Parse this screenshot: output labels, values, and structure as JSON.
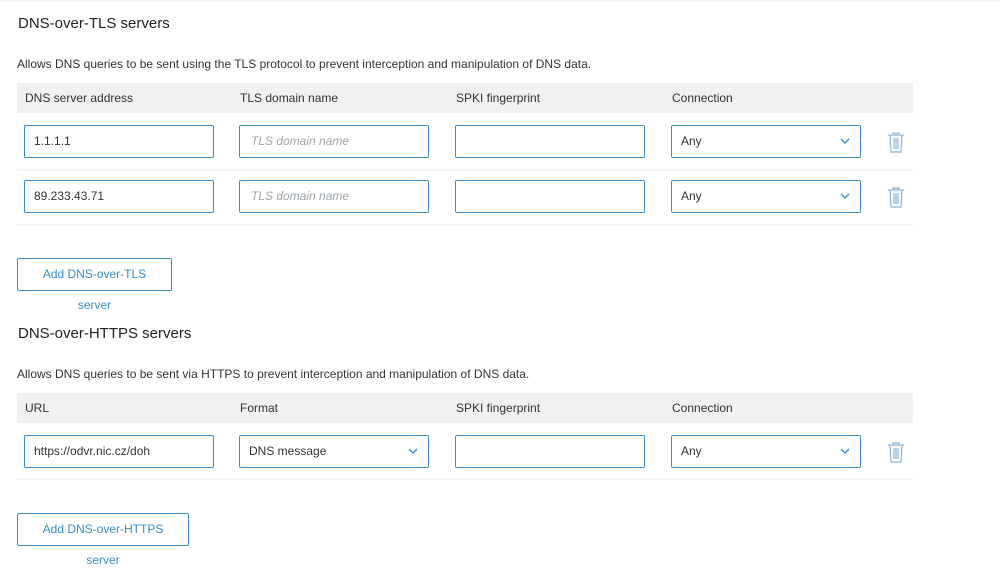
{
  "dot": {
    "title": "DNS-over-TLS servers",
    "description": "Allows DNS queries to be sent using the TLS protocol to prevent interception and manipulation of DNS data.",
    "columns": [
      "DNS server address",
      "TLS domain name",
      "SPKI fingerprint",
      "Connection"
    ],
    "rows": [
      {
        "address": "1.1.1.1",
        "tls_domain": "",
        "tls_placeholder": "TLS domain name",
        "spki": "",
        "connection": "Any"
      },
      {
        "address": "89.233.43.71",
        "tls_domain": "",
        "tls_placeholder": "TLS domain name",
        "spki": "",
        "connection": "Any"
      }
    ],
    "add_label": "Add DNS-over-TLS server"
  },
  "doh": {
    "title": "DNS-over-HTTPS servers",
    "description": "Allows DNS queries to be sent via HTTPS to prevent interception and manipulation of DNS data.",
    "columns": [
      "URL",
      "Format",
      "SPKI fingerprint",
      "Connection"
    ],
    "rows": [
      {
        "url": "https://odvr.nic.cz/doh",
        "format": "DNS message",
        "spki": "",
        "connection": "Any"
      }
    ],
    "add_label": "Add DNS-over-HTTPS server"
  },
  "icons": {
    "delete": "trash-icon",
    "dropdown": "chevron-down-icon"
  },
  "colors": {
    "accent": "#3a8dc9",
    "header_bg": "#f0f1f3",
    "icon": "#8fb8dc"
  }
}
